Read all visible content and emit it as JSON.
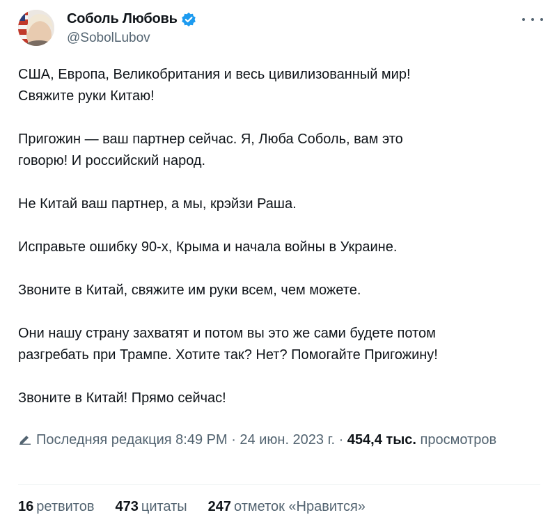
{
  "author": {
    "display_name": "Соболь Любовь",
    "handle": "@SobolLubov",
    "verified_color": "#1d9bf0"
  },
  "tweet": {
    "paragraphs": [
      "США, Европа, Великобритания и весь цивилизованный мир!\nСвяжите руки Китаю!",
      "Пригожин — ваш партнер сейчас. Я, Люба Соболь, вам это\nговорю! И российский народ.",
      "Не Китай ваш партнер, а мы, крэйзи Раша.",
      "Исправьте ошибку 90-х, Крыма и начала войны в Украине.",
      "Звоните в Китай, свяжите им руки всем, чем можете.",
      "Они нашу страну захватят и потом вы это же сами будете потом\nразгребать при Трампе. Хотите так? Нет? Помогайте Пригожину!",
      "Звоните в Китай! Прямо сейчас!"
    ]
  },
  "meta": {
    "edit_icon": "pencil-icon",
    "edited_label": "Последняя редакция",
    "time": "8:49 PM",
    "separator": " · ",
    "date": "24 июн. 2023 г.",
    "views_count": "454,4 тыс.",
    "views_label": "просмотров"
  },
  "stats": {
    "retweets_count": "16",
    "retweets_label": "ретвитов",
    "quotes_count": "473",
    "quotes_label": "цитаты",
    "likes_count": "247",
    "likes_label": "отметок «Нравится»"
  },
  "icons": {
    "more": "more-horizontal-icon",
    "verified": "verified-badge-icon"
  }
}
